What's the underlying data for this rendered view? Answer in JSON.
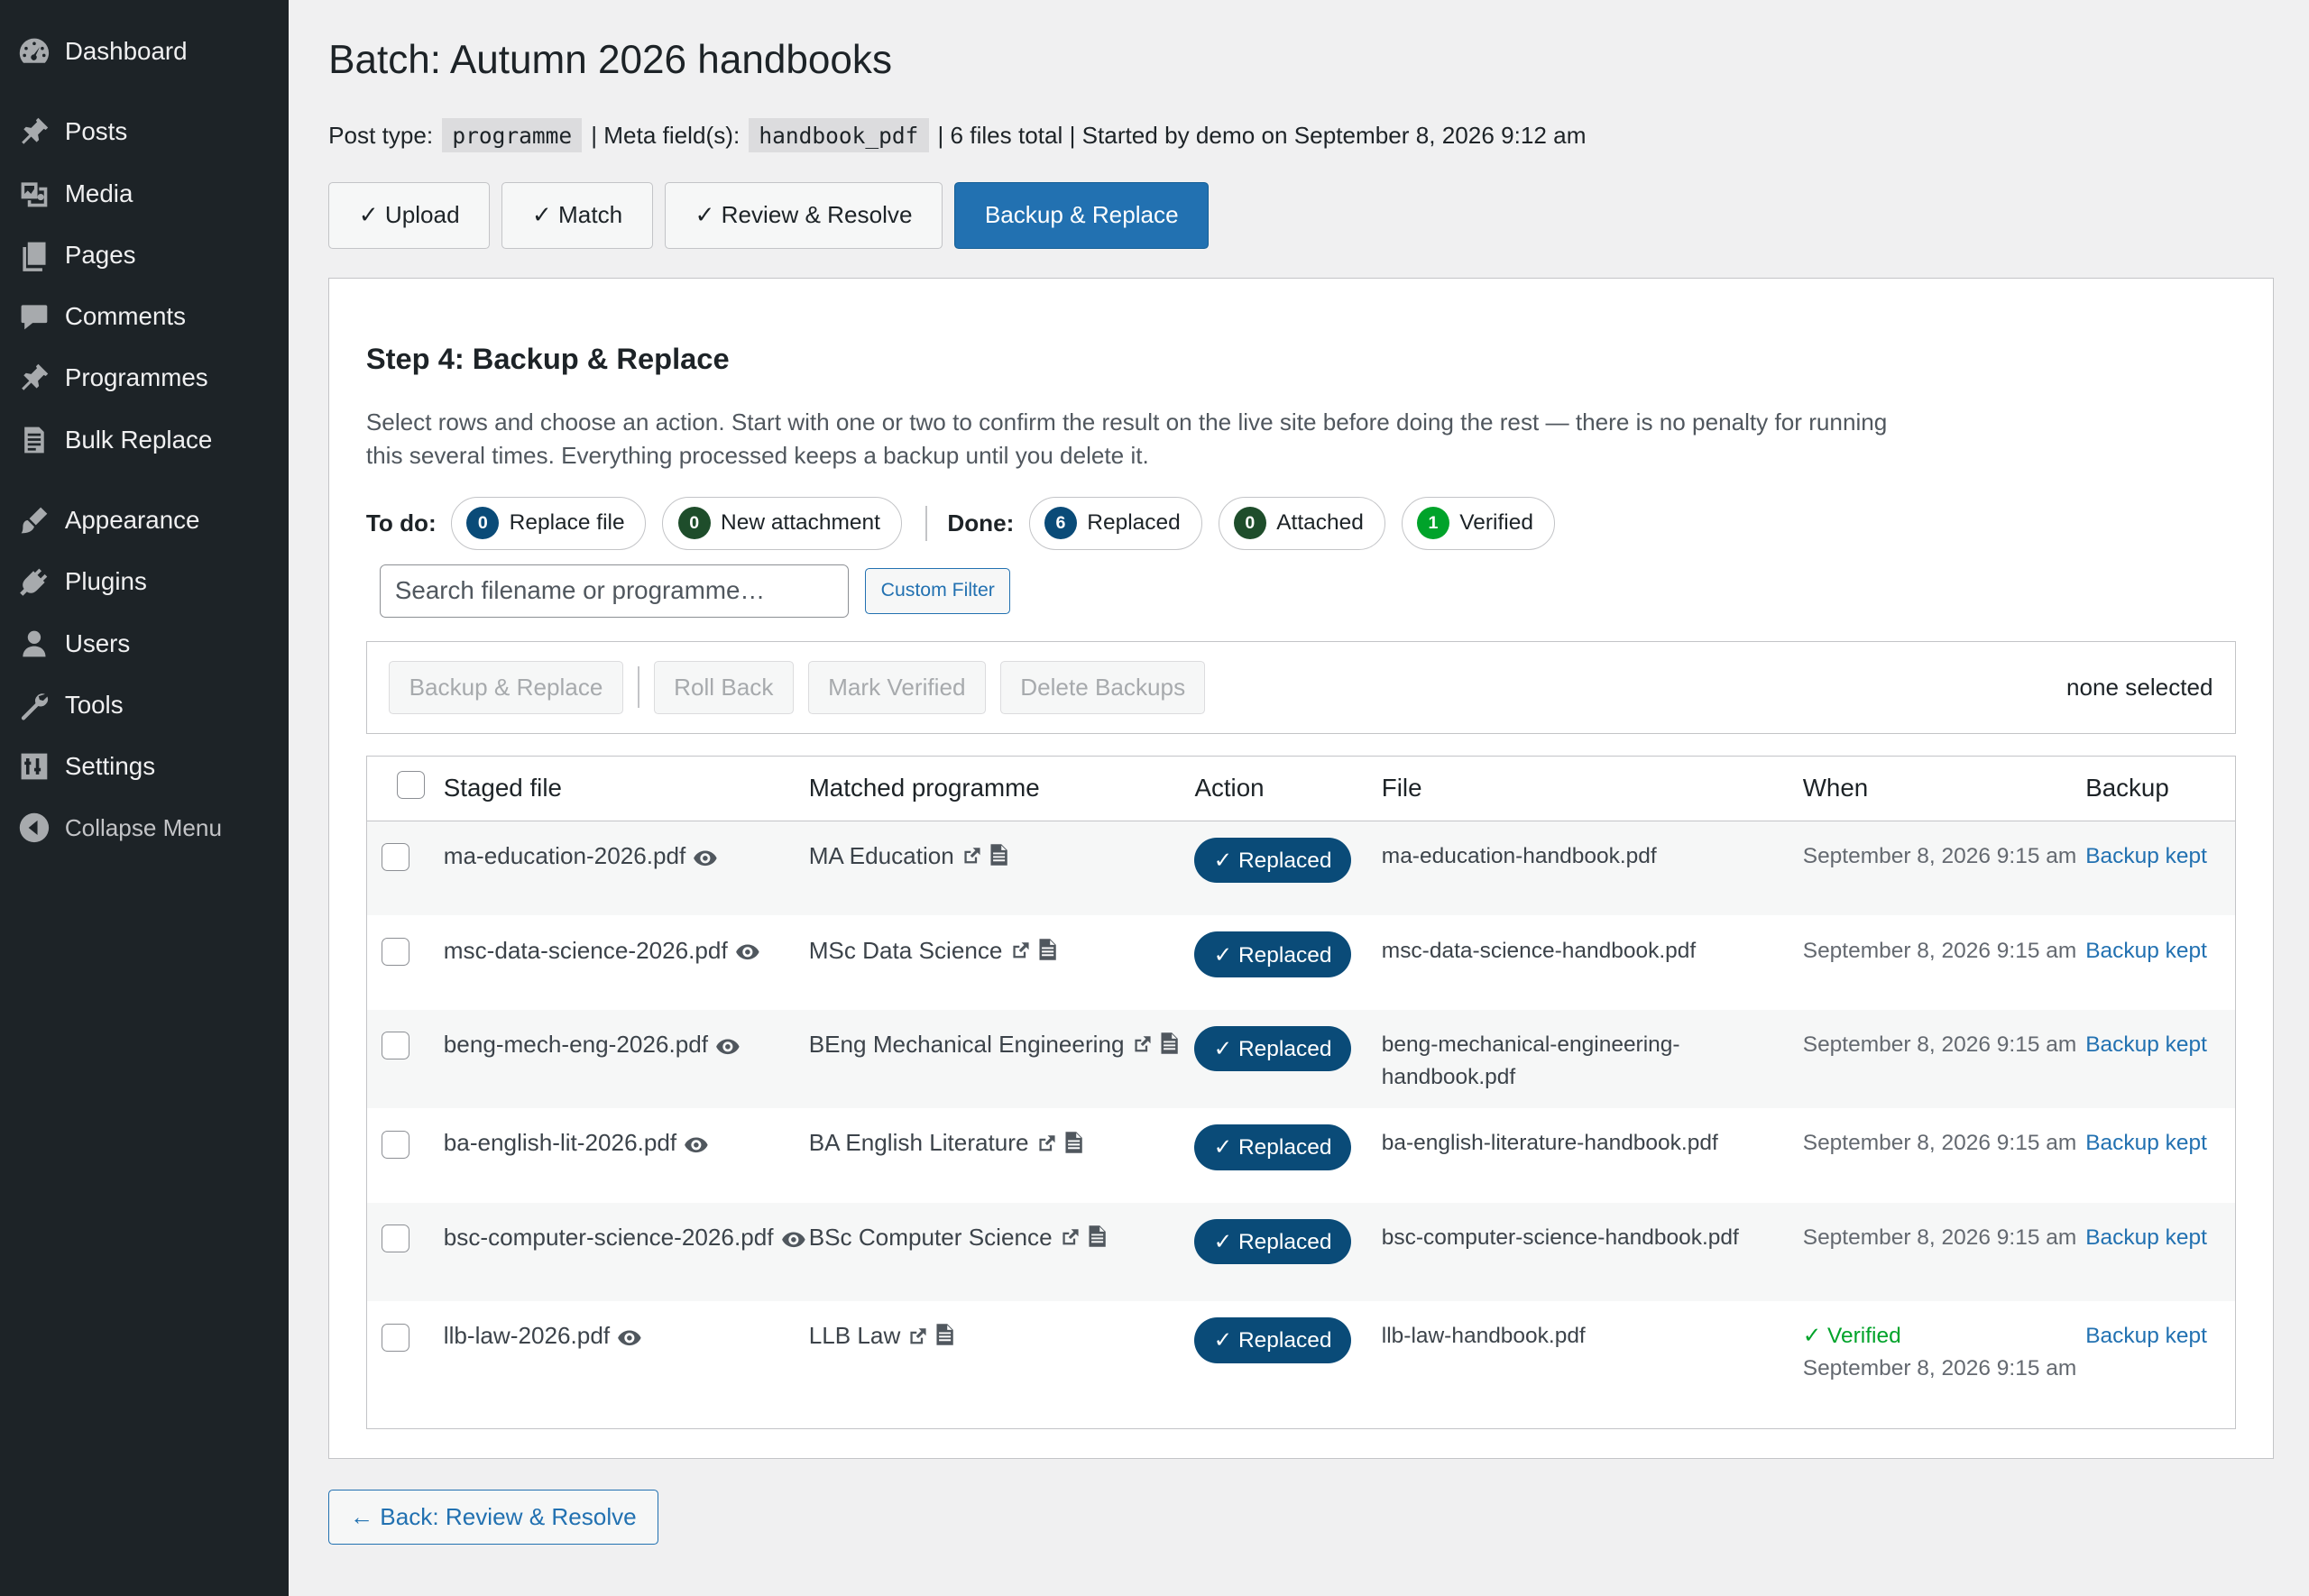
{
  "sidebar": {
    "items": [
      {
        "label": "Dashboard",
        "icon": "dashboard-icon"
      },
      {
        "label": "Posts",
        "icon": "pin-icon"
      },
      {
        "label": "Media",
        "icon": "media-icon"
      },
      {
        "label": "Pages",
        "icon": "pages-icon"
      },
      {
        "label": "Comments",
        "icon": "comments-icon"
      },
      {
        "label": "Programmes",
        "icon": "pin-icon"
      },
      {
        "label": "Bulk Replace",
        "icon": "document-icon"
      },
      {
        "label": "Appearance",
        "icon": "brush-icon"
      },
      {
        "label": "Plugins",
        "icon": "plug-icon"
      },
      {
        "label": "Users",
        "icon": "user-icon"
      },
      {
        "label": "Tools",
        "icon": "wrench-icon"
      },
      {
        "label": "Settings",
        "icon": "sliders-icon"
      }
    ],
    "collapse_label": "Collapse Menu"
  },
  "page": {
    "title": "Batch: Autumn 2026 handbooks",
    "post_type_label": "Post type:",
    "post_type": "programme",
    "meta_label": "| Meta field(s):",
    "meta_field": "handbook_pdf",
    "summary": "| 6 files total | Started by demo on September 8, 2026 9:12 am"
  },
  "steps": [
    {
      "label": "✓ Upload",
      "active": false
    },
    {
      "label": "✓ Match",
      "active": false
    },
    {
      "label": "✓ Review & Resolve",
      "active": false
    },
    {
      "label": "Backup & Replace",
      "active": true
    }
  ],
  "panel": {
    "heading": "Step 4: Backup & Replace",
    "intro": "Select rows and choose an action. Start with one or two to confirm the result on the live site before doing the rest — there is no penalty for running this several times. Everything processed keeps a backup until you delete it.",
    "todo_label": "To do:",
    "done_label": "Done:",
    "todo": [
      {
        "count": "0",
        "label": "Replace file",
        "color": "#0a4b78"
      },
      {
        "count": "0",
        "label": "New attachment",
        "color": "#1e4d2b"
      }
    ],
    "done": [
      {
        "count": "6",
        "label": "Replaced",
        "color": "#0a4b78"
      },
      {
        "count": "0",
        "label": "Attached",
        "color": "#1e4d2b"
      },
      {
        "count": "1",
        "label": "Verified",
        "color": "#00a32a"
      }
    ],
    "search_placeholder": "Search filename or programme…",
    "custom_filter": "Custom Filter",
    "bulk": {
      "backup_replace": "Backup & Replace",
      "roll_back": "Roll Back",
      "mark_verified": "Mark Verified",
      "delete_backups": "Delete Backups",
      "selection": "none selected"
    },
    "columns": {
      "staged": "Staged file",
      "programme": "Matched programme",
      "action": "Action",
      "file": "File",
      "when": "When",
      "backup": "Backup"
    },
    "rows": [
      {
        "staged": "ma-education-2026.pdf",
        "programme": "MA Education",
        "action": "✓ Replaced",
        "file": "ma-education-handbook.pdf",
        "verified": "",
        "when": "September 8, 2026 9:15 am",
        "backup": "Backup kept"
      },
      {
        "staged": "msc-data-science-2026.pdf",
        "programme": "MSc Data Science",
        "action": "✓ Replaced",
        "file": "msc-data-science-handbook.pdf",
        "verified": "",
        "when": "September 8, 2026 9:15 am",
        "backup": "Backup kept"
      },
      {
        "staged": "beng-mech-eng-2026.pdf",
        "programme": "BEng Mechanical Engineering",
        "action": "✓ Replaced",
        "file": "beng-mechanical-engineering-handbook.pdf",
        "verified": "",
        "when": "September 8, 2026 9:15 am",
        "backup": "Backup kept"
      },
      {
        "staged": "ba-english-lit-2026.pdf",
        "programme": "BA English Literature",
        "action": "✓ Replaced",
        "file": "ba-english-literature-handbook.pdf",
        "verified": "",
        "when": "September 8, 2026 9:15 am",
        "backup": "Backup kept"
      },
      {
        "staged": "bsc-computer-science-2026.pdf",
        "programme": "BSc Computer Science",
        "action": "✓ Replaced",
        "file": "bsc-computer-science-handbook.pdf",
        "verified": "",
        "when": "September 8, 2026 9:15 am",
        "backup": "Backup kept"
      },
      {
        "staged": "llb-law-2026.pdf",
        "programme": "LLB Law",
        "action": "✓ Replaced",
        "file": "llb-law-handbook.pdf",
        "verified": "✓ Verified",
        "when": "September 8, 2026 9:15 am",
        "backup": "Backup kept"
      }
    ]
  },
  "back_button": "← Back: Review & Resolve"
}
